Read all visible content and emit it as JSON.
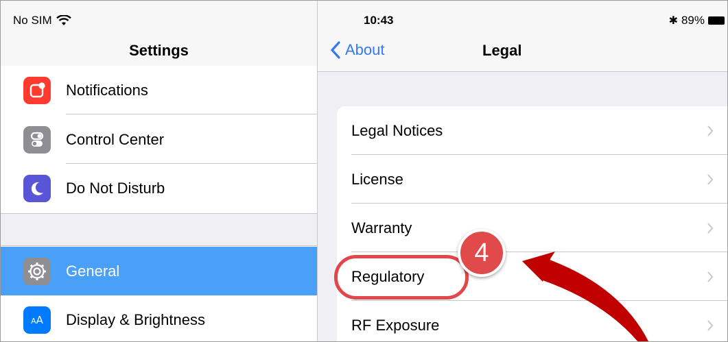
{
  "status_bar": {
    "carrier": "No SIM",
    "time": "10:43",
    "battery": "89%"
  },
  "sidebar": {
    "title": "Settings",
    "items": [
      {
        "label": "Notifications",
        "icon": "notifications-icon",
        "color": "#ff3b30"
      },
      {
        "label": "Control Center",
        "icon": "control-center-icon",
        "color": "#8e8e93"
      },
      {
        "label": "Do Not Disturb",
        "icon": "moon-icon",
        "color": "#5856d6"
      },
      {
        "label": "General",
        "icon": "gear-icon",
        "color": "#8e8e93",
        "selected": true
      },
      {
        "label": "Display & Brightness",
        "icon": "display-icon",
        "color": "#007aff"
      }
    ]
  },
  "detail": {
    "back_label": "About",
    "title": "Legal",
    "items": [
      {
        "label": "Legal Notices"
      },
      {
        "label": "License"
      },
      {
        "label": "Warranty"
      },
      {
        "label": "Regulatory"
      },
      {
        "label": "RF Exposure"
      }
    ]
  },
  "annotation": {
    "step_number": "4",
    "highlight_color": "#e0484b",
    "arrow_color": "#c00000"
  },
  "colors": {
    "accent": "#3478f6",
    "selection": "#4a9ff6"
  }
}
